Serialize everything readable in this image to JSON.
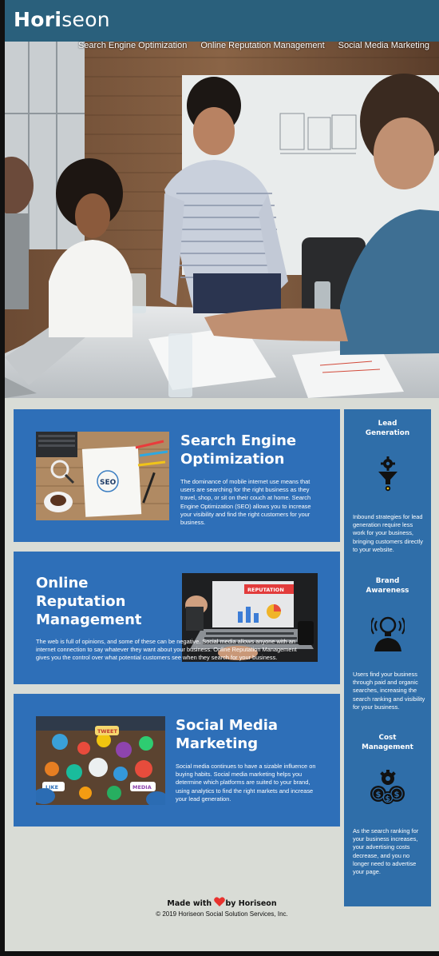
{
  "header": {
    "logo_main": "Hori",
    "logo_accent": "seon",
    "nav": [
      {
        "label": "Search Engine Optimization"
      },
      {
        "label": "Online Reputation Management"
      },
      {
        "label": "Social Media Marketing"
      }
    ]
  },
  "content": {
    "seo": {
      "title_line1": "Search Engine",
      "title_line2": "Optimization",
      "body": "The dominance of mobile internet use means that users are searching for the right business as they travel, shop, or sit on their couch at home. Search Engine Optimization (SEO) allows you to increase your visibility and find the right customers for your business."
    },
    "orm": {
      "title_line1": "Online",
      "title_line2": "Reputation",
      "title_line3": "Management",
      "body": "The web is full of opinions, and some of these can be negative. Social media allows anyone with an internet connection to say whatever they want about your business. Online Reputation Management gives you the control over what potential customers see when they search for your business."
    },
    "smm": {
      "title_line1": "Social Media",
      "title_line2": "Marketing",
      "body": "Social media continues to have a sizable influence on buying habits. Social media marketing helps you determine which platforms are suited to your brand, using analytics to find the right markets and increase your lead generation."
    }
  },
  "sidebar": {
    "lead": {
      "title_line1": "Lead",
      "title_line2": "Generation",
      "icon": "funnel-gear-icon",
      "body": "Inbound strategies for lead generation require less work for your business, bringing customers directly to your website."
    },
    "brand": {
      "title_line1": "Brand",
      "title_line2": "Awareness",
      "icon": "lightbulb-head-icon",
      "body": "Users find your business through paid and organic searches, increasing the search ranking and visibility for your business."
    },
    "cost": {
      "title_line1": "Cost",
      "title_line2": "Management",
      "icon": "gear-dollar-icon",
      "body": "As the search ranking for your business increases, your advertising costs decrease, and you no longer need to advertise your page."
    }
  },
  "footer": {
    "made_with": "Made with",
    "by": "by Horiseon",
    "copyright": "© 2019 Horiseon Social Solution Services, Inc."
  },
  "colors": {
    "header_bg": "#2a607c",
    "block_bg": "#2e6fb8",
    "sidebar_bg": "#2f6ea9",
    "page_bg": "#d9dcd6",
    "heart": "#e8322e"
  },
  "images": {
    "reputation_label": "REPUTATION",
    "social_words": [
      "TWEET",
      "LIKE",
      "MEDIA"
    ],
    "seo_label": "SEO"
  }
}
